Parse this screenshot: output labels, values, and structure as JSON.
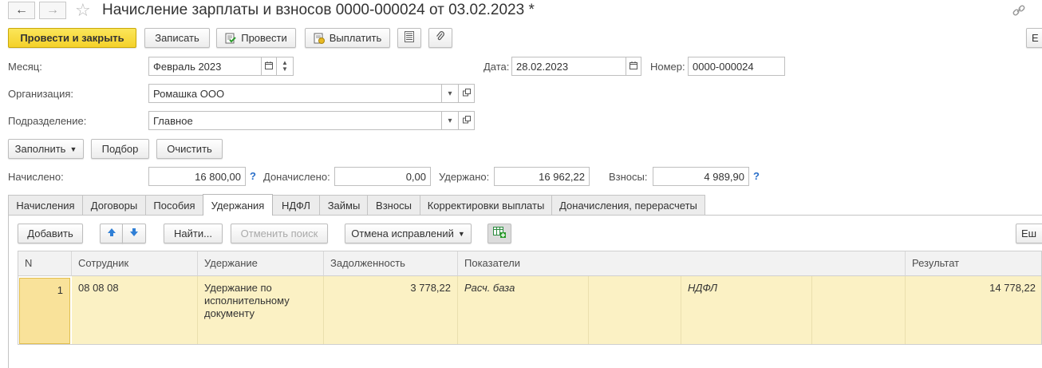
{
  "window": {
    "title": "Начисление зарплаты и взносов 0000-000024 от 03.02.2023 *",
    "back_icon": "arrow-left",
    "forward_icon": "arrow-right",
    "star_icon": "star-outline",
    "link_icon": "link"
  },
  "toolbar": {
    "post_close": "Провести и закрыть",
    "save": "Записать",
    "post": "Провести",
    "pay": "Выплатить",
    "more_right": "Е"
  },
  "header": {
    "month_label": "Месяц:",
    "month_value": "Февраль 2023",
    "date_label": "Дата:",
    "date_value": "28.02.2023",
    "number_label": "Номер:",
    "number_value": "0000-000024",
    "org_label": "Организация:",
    "org_value": "Ромашка ООО",
    "dept_label": "Подразделение:",
    "dept_value": "Главное"
  },
  "actions": {
    "fill": "Заполнить",
    "pick": "Подбор",
    "clear": "Очистить"
  },
  "totals": {
    "accrued_label": "Начислено:",
    "accrued_value": "16 800,00",
    "additional_label": "Доначислено:",
    "additional_value": "0,00",
    "withheld_label": "Удержано:",
    "withheld_value": "16 962,22",
    "contrib_label": "Взносы:",
    "contrib_value": "4 989,90",
    "help": "?"
  },
  "tabs": [
    {
      "label": "Начисления"
    },
    {
      "label": "Договоры"
    },
    {
      "label": "Пособия"
    },
    {
      "label": "Удержания",
      "active": true
    },
    {
      "label": "НДФЛ"
    },
    {
      "label": "Займы"
    },
    {
      "label": "Взносы"
    },
    {
      "label": "Корректировки выплаты"
    },
    {
      "label": "Доначисления, перерасчеты"
    }
  ],
  "table_toolbar": {
    "add": "Добавить",
    "find": "Найти...",
    "cancel_search": "Отменить поиск",
    "cancel_corrections": "Отмена исправлений",
    "more": "Еш"
  },
  "table": {
    "columns": [
      "N",
      "Сотрудник",
      "Удержание",
      "Задолженность",
      "Показатели",
      "Результат"
    ],
    "rows": [
      {
        "n": "1",
        "employee": "08 08 08",
        "deduction": "Удержание по исполнительному документу",
        "debt": "3 778,22",
        "indicator1": "Расч. база",
        "indicator2": "НДФЛ",
        "result": "14 778,22"
      }
    ]
  },
  "colors": {
    "primary_button": "#f4d12a",
    "row_highlight": "#fbf1c4",
    "help_blue": "#2a6fc9"
  }
}
